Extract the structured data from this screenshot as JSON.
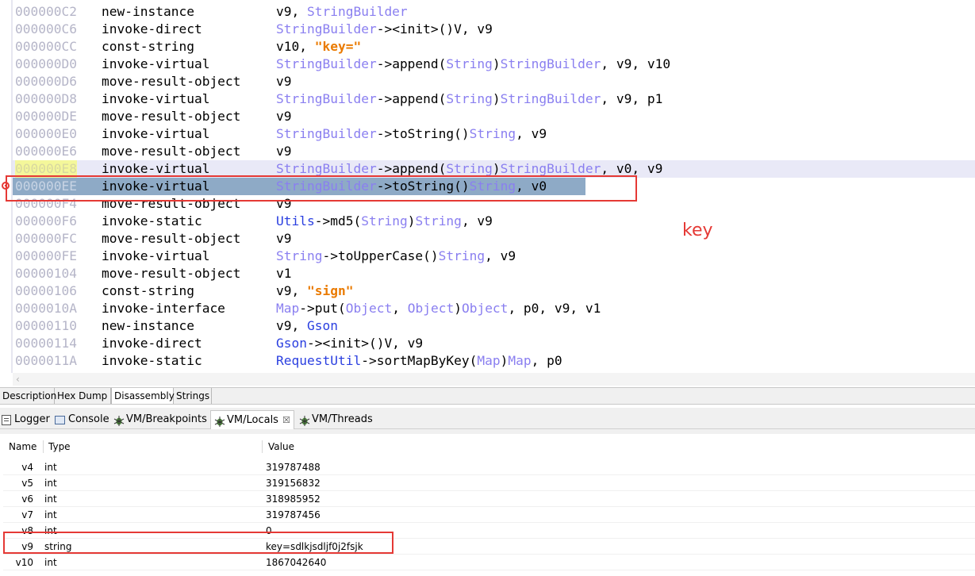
{
  "code_lines": [
    {
      "addr": "000000C2",
      "op": "new-instance",
      "args": [
        [
          "v9, ",
          "p"
        ],
        [
          "StringBuilder",
          "c"
        ]
      ]
    },
    {
      "addr": "000000C6",
      "op": "invoke-direct",
      "args": [
        [
          "StringBuilder",
          "c"
        ],
        [
          "-><init>()V, v9",
          "p"
        ]
      ]
    },
    {
      "addr": "000000CC",
      "op": "const-string",
      "args": [
        [
          "v10, ",
          "p"
        ],
        [
          "\"key=\"",
          "s"
        ]
      ]
    },
    {
      "addr": "000000D0",
      "op": "invoke-virtual",
      "args": [
        [
          "StringBuilder",
          "c"
        ],
        [
          "->append(",
          "p"
        ],
        [
          "String",
          "c"
        ],
        [
          ")",
          "p"
        ],
        [
          "StringBuilder",
          "c"
        ],
        [
          ", v9, v10",
          "p"
        ]
      ]
    },
    {
      "addr": "000000D6",
      "op": "move-result-object",
      "args": [
        [
          "v9",
          "p"
        ]
      ]
    },
    {
      "addr": "000000D8",
      "op": "invoke-virtual",
      "args": [
        [
          "StringBuilder",
          "c"
        ],
        [
          "->append(",
          "p"
        ],
        [
          "String",
          "c"
        ],
        [
          ")",
          "p"
        ],
        [
          "StringBuilder",
          "c"
        ],
        [
          ", v9, p1",
          "p"
        ]
      ]
    },
    {
      "addr": "000000DE",
      "op": "move-result-object",
      "args": [
        [
          "v9",
          "p"
        ]
      ]
    },
    {
      "addr": "000000E0",
      "op": "invoke-virtual",
      "args": [
        [
          "StringBuilder",
          "c"
        ],
        [
          "->toString()",
          "p"
        ],
        [
          "String",
          "c"
        ],
        [
          ", v9",
          "p"
        ]
      ]
    },
    {
      "addr": "000000E6",
      "op": "move-result-object",
      "args": [
        [
          "v9",
          "p"
        ]
      ]
    },
    {
      "addr": "000000E8",
      "op": "invoke-virtual",
      "args": [
        [
          "StringBuilder",
          "c"
        ],
        [
          "->append(",
          "p"
        ],
        [
          "String",
          "c"
        ],
        [
          ")",
          "p"
        ],
        [
          "StringBuilder",
          "c"
        ],
        [
          ", v0, v9",
          "p"
        ]
      ],
      "state": "hover"
    },
    {
      "addr": "000000EE",
      "op": "invoke-virtual",
      "args": [
        [
          "StringBuilder",
          "c"
        ],
        [
          "->toString()",
          "p"
        ],
        [
          "String",
          "c"
        ],
        [
          ", v0",
          "p"
        ]
      ],
      "state": "selected"
    },
    {
      "addr": "000000F4",
      "op": "move-result-object",
      "args": [
        [
          "v9",
          "p"
        ]
      ]
    },
    {
      "addr": "000000F6",
      "op": "invoke-static",
      "args": [
        [
          "Utils",
          "u"
        ],
        [
          "->md5(",
          "p"
        ],
        [
          "String",
          "c"
        ],
        [
          ")",
          "p"
        ],
        [
          "String",
          "c"
        ],
        [
          ", v9",
          "p"
        ]
      ]
    },
    {
      "addr": "000000FC",
      "op": "move-result-object",
      "args": [
        [
          "v9",
          "p"
        ]
      ]
    },
    {
      "addr": "000000FE",
      "op": "invoke-virtual",
      "args": [
        [
          "String",
          "c"
        ],
        [
          "->toUpperCase()",
          "p"
        ],
        [
          "String",
          "c"
        ],
        [
          ", v9",
          "p"
        ]
      ]
    },
    {
      "addr": "00000104",
      "op": "move-result-object",
      "args": [
        [
          "v1",
          "p"
        ]
      ]
    },
    {
      "addr": "00000106",
      "op": "const-string",
      "args": [
        [
          "v9, ",
          "p"
        ],
        [
          "\"sign\"",
          "s"
        ]
      ]
    },
    {
      "addr": "0000010A",
      "op": "invoke-interface",
      "args": [
        [
          "Map",
          "c"
        ],
        [
          "->put(",
          "p"
        ],
        [
          "Object",
          "c"
        ],
        [
          ", ",
          "p"
        ],
        [
          "Object",
          "c"
        ],
        [
          ")",
          "p"
        ],
        [
          "Object",
          "c"
        ],
        [
          ", p0, v9, v1",
          "p"
        ]
      ]
    },
    {
      "addr": "00000110",
      "op": "new-instance",
      "args": [
        [
          "v9, ",
          "p"
        ],
        [
          "Gson",
          "u"
        ]
      ]
    },
    {
      "addr": "00000114",
      "op": "invoke-direct",
      "args": [
        [
          "Gson",
          "u"
        ],
        [
          "-><init>()V, v9",
          "p"
        ]
      ]
    },
    {
      "addr": "0000011A",
      "op": "invoke-static",
      "args": [
        [
          "RequestUtil",
          "u"
        ],
        [
          "->sortMapByKey(",
          "p"
        ],
        [
          "Map",
          "c"
        ],
        [
          ")",
          "p"
        ],
        [
          "Map",
          "c"
        ],
        [
          ", p0",
          "p"
        ]
      ]
    }
  ],
  "annotation": "key",
  "view_tabs": [
    "Description",
    "Hex Dump",
    "Disassembly",
    "Strings"
  ],
  "active_view_tab": "Disassembly",
  "panel_tabs": [
    {
      "label": "Logger",
      "icon": "logger-icon"
    },
    {
      "label": "Console",
      "icon": "console-icon"
    },
    {
      "label": "VM/Breakpoints",
      "icon": "bug-icon"
    },
    {
      "label": "VM/Locals",
      "icon": "bug-icon",
      "active": true,
      "closable": true
    },
    {
      "label": "VM/Threads",
      "icon": "bug-icon"
    }
  ],
  "locals": {
    "headers": [
      "Name",
      "Type",
      "Value"
    ],
    "rows": [
      {
        "name": "v4",
        "type": "int",
        "value": "319787488"
      },
      {
        "name": "v5",
        "type": "int",
        "value": "319156832"
      },
      {
        "name": "v6",
        "type": "int",
        "value": "318985952"
      },
      {
        "name": "v7",
        "type": "int",
        "value": "319787456"
      },
      {
        "name": "v8",
        "type": "int",
        "value": "0"
      },
      {
        "name": "v9",
        "type": "string",
        "value": "key=sdlkjsdljf0j2fsjk"
      },
      {
        "name": "v10",
        "type": "int",
        "value": "1867042640"
      }
    ]
  },
  "scroll_left_glyph": "‹",
  "close_glyph": "☒"
}
